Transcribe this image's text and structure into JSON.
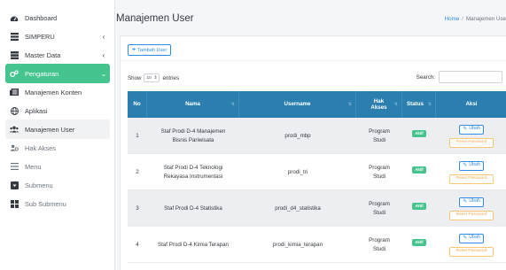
{
  "sidebar": {
    "items": [
      {
        "label": "Dashboard",
        "icon": "tachometer-icon"
      },
      {
        "label": "SIMPERU",
        "icon": "list-icon",
        "chevron": "‹"
      },
      {
        "label": "Master Data",
        "icon": "server-icon",
        "chevron": "‹"
      },
      {
        "label": "Pengaturan",
        "icon": "cogs-icon",
        "chevron": "⌄"
      },
      {
        "label": "Manajemen Konten",
        "icon": "newspaper-icon"
      },
      {
        "label": "Aplikasi",
        "icon": "globe-icon"
      },
      {
        "label": "Manajemen User",
        "icon": "users-icon"
      },
      {
        "label": "Hak Akses",
        "icon": "users-cog-icon"
      },
      {
        "label": "Menu",
        "icon": "bars-icon"
      },
      {
        "label": "Submenu",
        "icon": "caret-square-icon"
      },
      {
        "label": "Sub Submenu",
        "icon": "th-large-icon"
      }
    ]
  },
  "header": {
    "title": "Manajemen User",
    "breadcrumb": {
      "home": "Home",
      "separator": "/",
      "current": "Manajemen Use"
    }
  },
  "toolbar": {
    "add_label": "Tambah User",
    "add_icon": "plus-icon"
  },
  "datatable": {
    "show_prefix": "Show",
    "entries_value": "10",
    "show_suffix": "entries",
    "search_label": "Search:",
    "search_value": ""
  },
  "table": {
    "headers": {
      "no": "No",
      "nama": "Nama",
      "username": "Username",
      "hak_akses": "Hak Akses",
      "status": "Status",
      "aksi": "Aksi"
    },
    "rows": [
      {
        "no": "1",
        "nama": "Staf Prodi D-4 Manajemen Bisnis Pariwisata",
        "username": "prodi_mbp",
        "hak_akses": "Program Studi",
        "status": "Aktif"
      },
      {
        "no": "2",
        "nama": "Staf Prodi D-4 Teknologi Rekayasa Instrumentasi",
        "username": "prodi_tri",
        "hak_akses": "Program Studi",
        "status": "Aktif"
      },
      {
        "no": "3",
        "nama": "Staf Prodi D-4 Statistika",
        "username": "prodi_d4_statistika",
        "hak_akses": "Program Studi",
        "status": "Aktif"
      },
      {
        "no": "4",
        "nama": "Staf Prodi D-4 Kimia Terapan",
        "username": "prodi_kimia_terapan",
        "hak_akses": "Program Studi",
        "status": "Aktif"
      }
    ],
    "edit_label": "Ubah",
    "reset_label": "Reset Password"
  },
  "colors": {
    "accent_green": "#45c48e",
    "table_header": "#2a7fae",
    "link_blue": "#2e8ce6",
    "warning": "#f0ad4e"
  }
}
